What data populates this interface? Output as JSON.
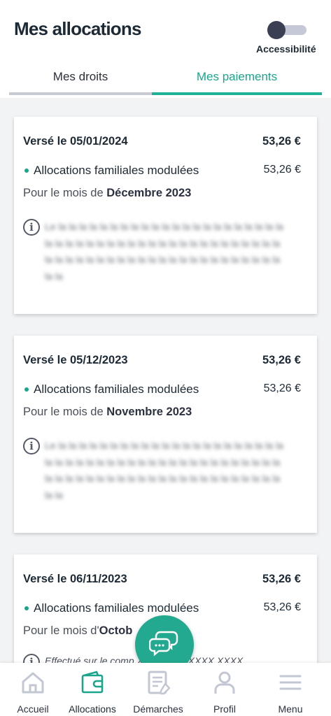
{
  "header": {
    "title": "Mes allocations",
    "accessibility_label": "Accessibilité"
  },
  "tabs": [
    {
      "label": "Mes droits",
      "active": false
    },
    {
      "label": "Mes paiements",
      "active": true
    }
  ],
  "payments": [
    {
      "date_label": "Versé le 05/01/2024",
      "total": "53,26 €",
      "allocation_label": "Allocations familiales modulées",
      "allocation_amount": "53,26 €",
      "month_prefix": "Pour le mois de ",
      "month": "Décembre 2023",
      "info_text": "Le la la la la la la la la la la la la la la la la la la la la la la la la la la la la la la la la la la la la la la la la la la la la la la la la la la la la la la la la la la la la la la la la la la la la la la"
    },
    {
      "date_label": "Versé le 05/12/2023",
      "total": "53,26 €",
      "allocation_label": "Allocations familiales modulées",
      "allocation_amount": "53,26 €",
      "month_prefix": "Pour le mois de ",
      "month": "Novembre 2023",
      "info_text": "Le la la la la la la la la la la la la la la la la la la la la la la la la la la la la la la la la la la la la la la la la la la la la la la la la la la la la la la la la la la la la la la la la la la la la la la"
    },
    {
      "date_label": "Versé le 06/11/2023",
      "total": "53,26 €",
      "allocation_label": "Allocations familiales modulées",
      "allocation_amount": "53,26 €",
      "month_prefix": "Pour le mois d'",
      "month": "Octob",
      "info_text": "Effectué sur le comp                    XXX XXXX XXXX XXXX"
    }
  ],
  "bottom_nav": [
    {
      "label": "Accueil",
      "icon": "home-icon"
    },
    {
      "label": "Allocations",
      "icon": "wallet-icon",
      "active": true
    },
    {
      "label": "Démarches",
      "icon": "document-icon"
    },
    {
      "label": "Profil",
      "icon": "user-icon"
    },
    {
      "label": "Menu",
      "icon": "menu-icon"
    }
  ],
  "colors": {
    "accent": "#1fb297",
    "fab": "#23a98f",
    "title": "#1d2a35"
  }
}
